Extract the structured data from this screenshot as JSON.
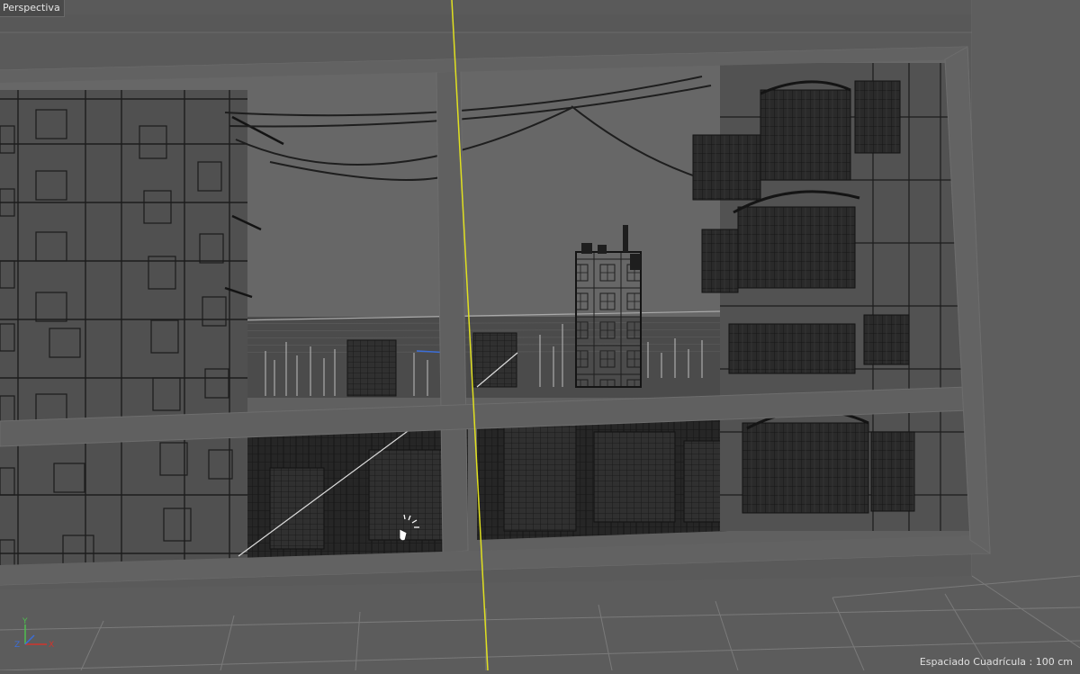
{
  "viewport": {
    "label": "Perspectiva",
    "grid_spacing_text": "Espaciado Cuadrícula : 100 cm"
  },
  "axis_gizmo": {
    "x_label": "X",
    "y_label": "Y",
    "z_label": "Z",
    "x_color": "#d0342c",
    "y_color": "#4fbf4f",
    "z_color": "#3c6ed8"
  },
  "colors": {
    "background": "#5b5b5b",
    "wall": "#595959",
    "frame": "#5f5f5f",
    "sky": "#686868",
    "wireframe": "#1f1f1f",
    "dense_wireframe": "#191919",
    "selection_axis": "#e0e020",
    "highlight_line": "#dcdcdc"
  },
  "icons": [
    "axis-gizmo-icon",
    "cursor-icon"
  ]
}
